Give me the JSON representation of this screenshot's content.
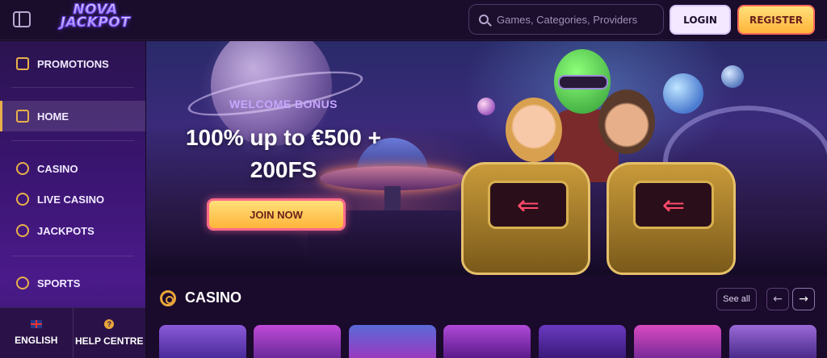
{
  "header": {
    "logo_line1": "NOVA",
    "logo_line2": "JACKPOT",
    "search_placeholder": "Games, Categories, Providers",
    "login_label": "LOGIN",
    "register_label": "REGISTER"
  },
  "sidebar": {
    "items": [
      {
        "label": "PROMOTIONS",
        "icon": "gift-icon"
      },
      {
        "label": "HOME",
        "icon": "home-icon"
      },
      {
        "label": "CASINO",
        "icon": "chip-icon"
      },
      {
        "label": "LIVE CASINO",
        "icon": "spade-icon"
      },
      {
        "label": "JACKPOTS",
        "icon": "seven-icon"
      },
      {
        "label": "SPORTS",
        "icon": "ball-icon"
      }
    ],
    "active": "HOME",
    "bottom": {
      "language_label": "ENGLISH",
      "help_label": "HELP CENTRE"
    }
  },
  "hero": {
    "welcome": "WELCOME BONUS",
    "headline_line1": "100% up to €500 +",
    "headline_line2": "200FS",
    "cta_label": "JOIN NOW"
  },
  "casino_section": {
    "title": "CASINO",
    "see_all_label": "See all",
    "prev_icon": "arrow-left-icon",
    "next_icon": "arrow-right-icon",
    "tile_count": 7
  },
  "colors": {
    "accent_gold": "#e8b04a",
    "register_gradient": "#ffb43a",
    "sidebar_purple": "#3a1570",
    "header_bg": "#1a0d2c"
  }
}
